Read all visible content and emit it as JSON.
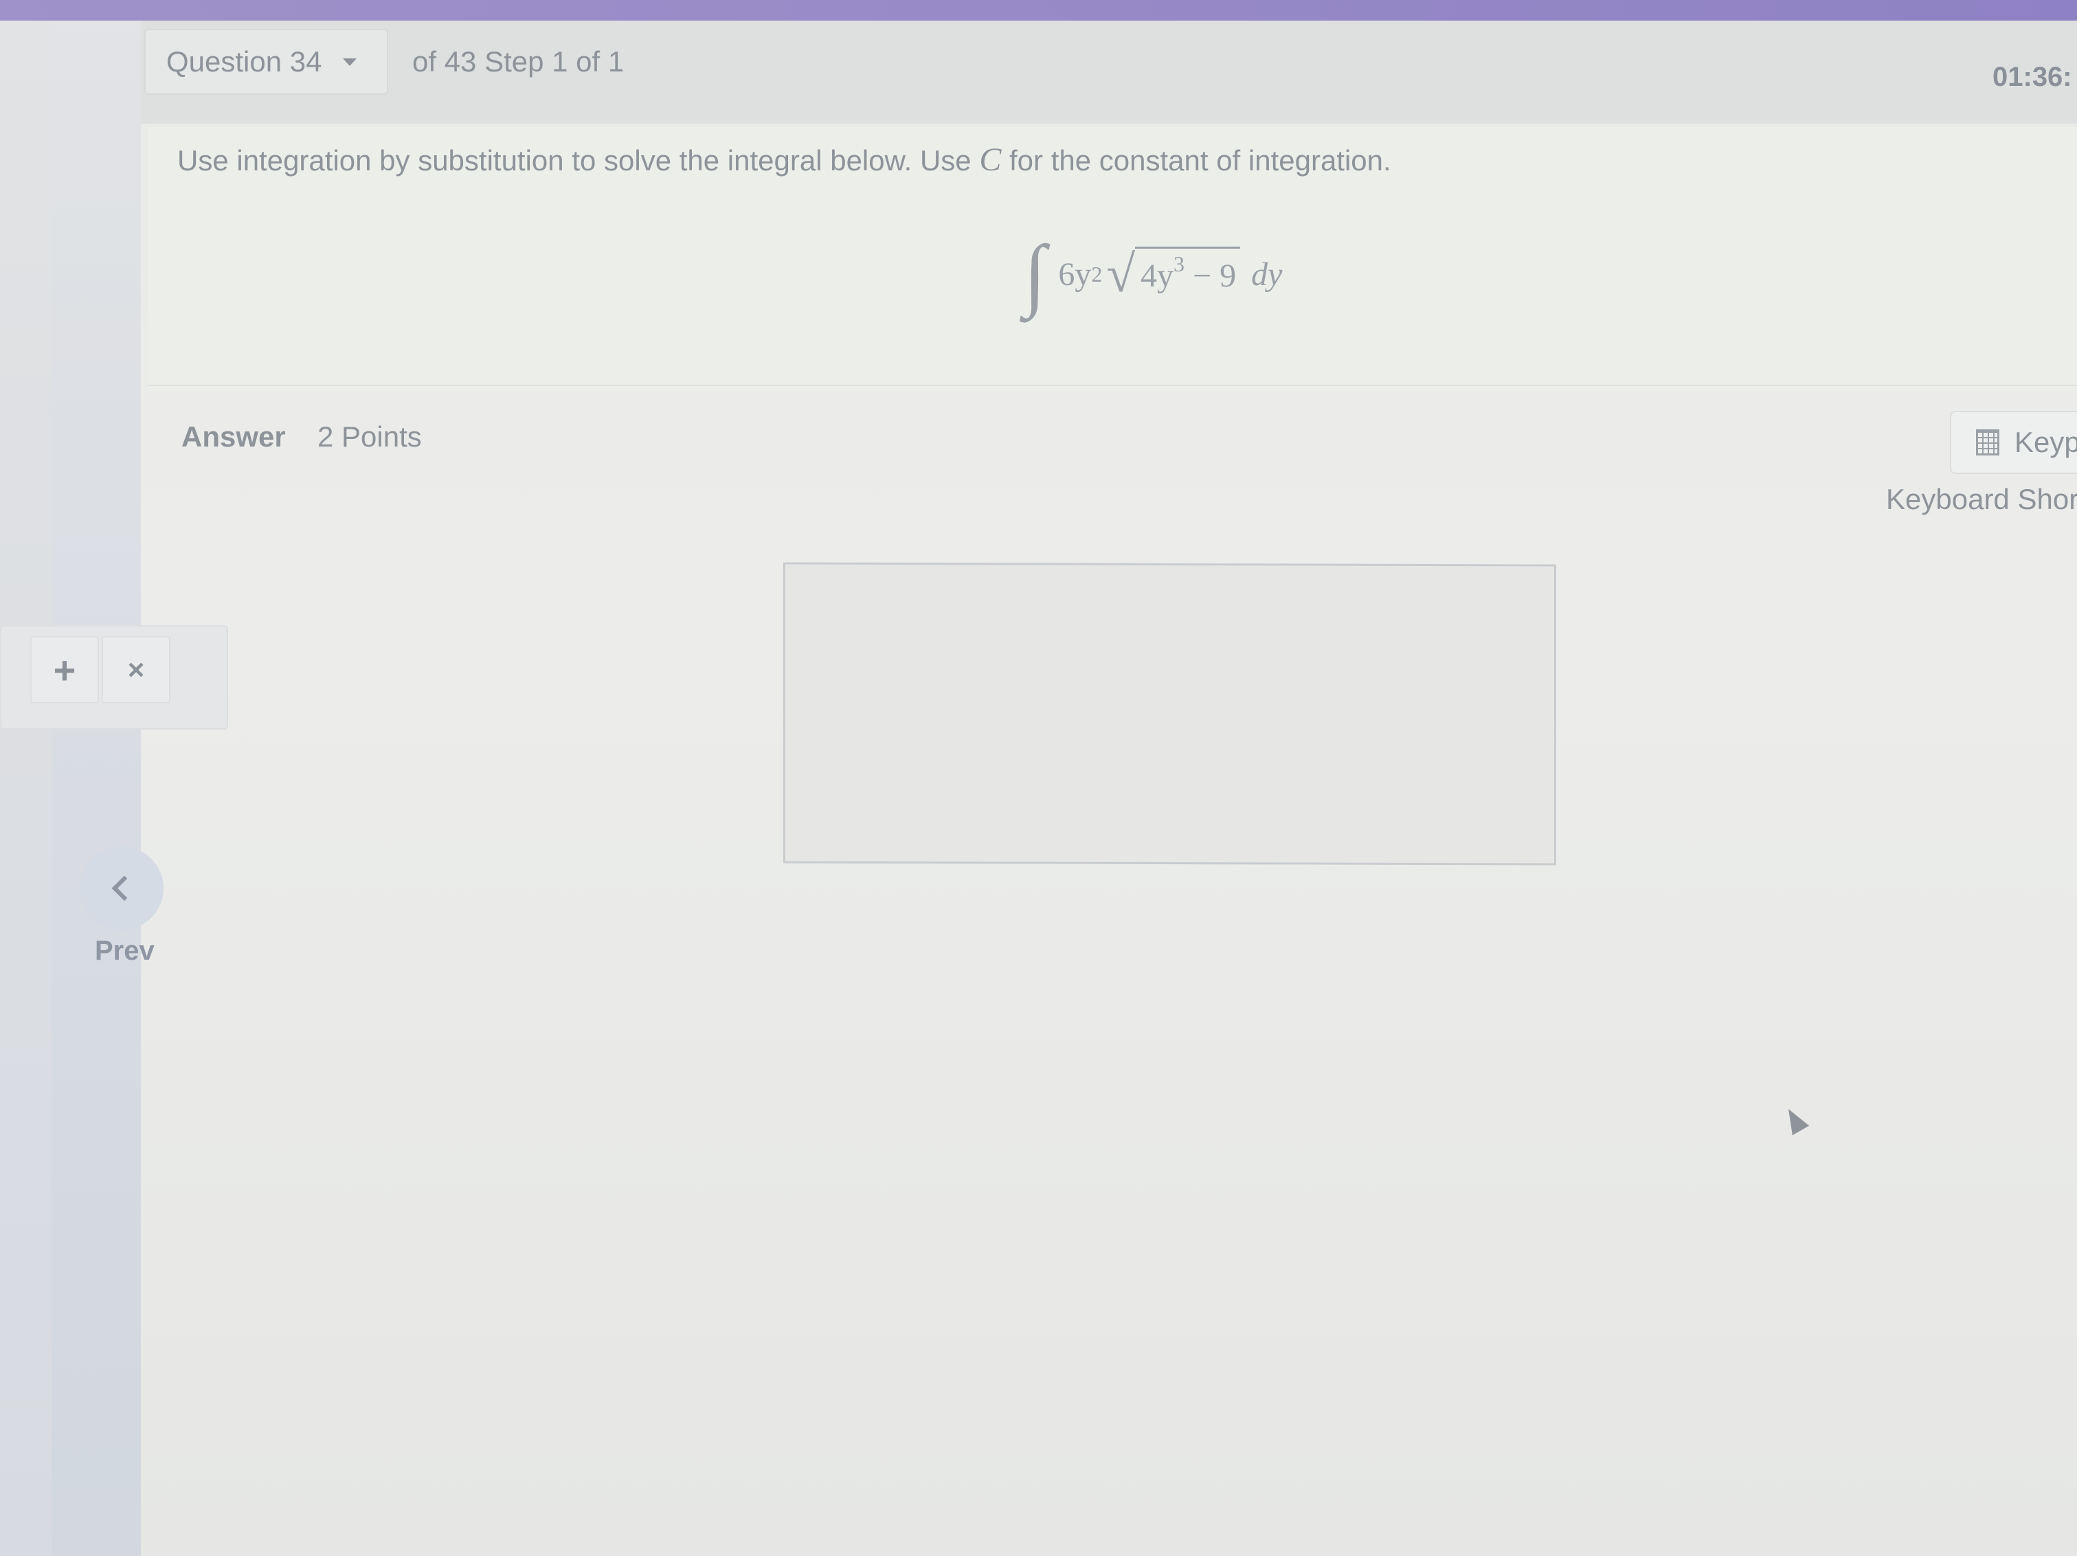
{
  "header": {
    "question_label": "Question 34",
    "step_text": "of 43 Step 1 of 1",
    "timer": "01:36:"
  },
  "question": {
    "prompt_before": "Use integration by substitution to solve the integral below. Use ",
    "prompt_var": "C",
    "prompt_after": " for the constant of integration.",
    "integrand_coefficient": "6y",
    "integrand_power": "2",
    "radicand_base": "4y",
    "radicand_power": "3",
    "radicand_rest": " − 9",
    "differential": "dy"
  },
  "answer": {
    "label": "Answer",
    "points": "2 Points"
  },
  "tools": {
    "keypad_label": "Keyp",
    "keyboard_shortcuts": "Keyboard Shor",
    "add_symbol": "+",
    "remove_symbol": "×"
  },
  "nav": {
    "prev_label": "Prev"
  },
  "colors": {
    "top_bar": "#9f91c9",
    "text": "#8d9399"
  }
}
